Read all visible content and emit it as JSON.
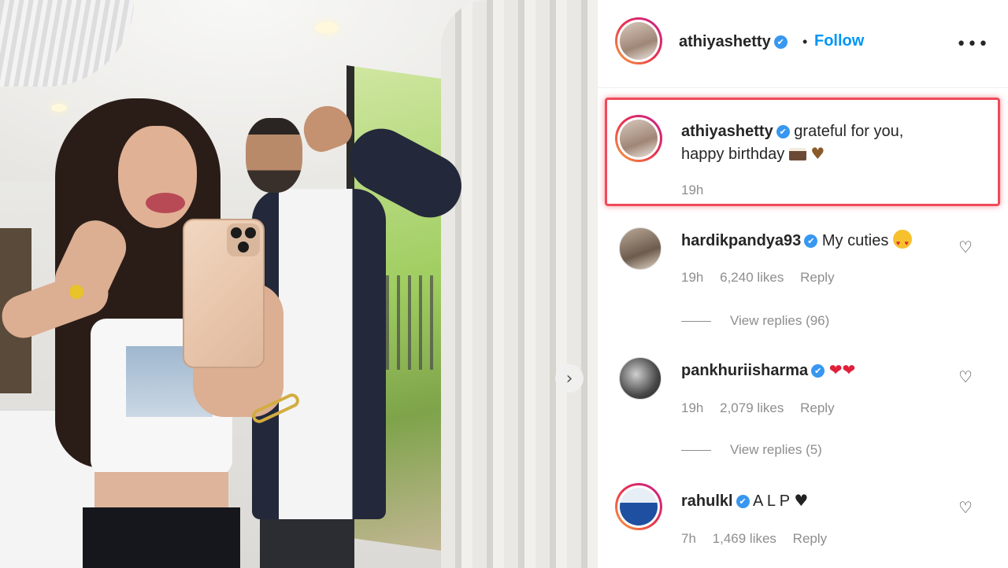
{
  "post": {
    "username": "athiyashetty",
    "follow_label": "Follow",
    "separator": "•",
    "more_label": "•••"
  },
  "caption": {
    "username": "athiyashetty",
    "text_line1": "grateful for you,",
    "text_line2": "happy birthday",
    "time": "19h"
  },
  "comments": [
    {
      "username": "hardikpandya93",
      "text": "My cuties",
      "time": "19h",
      "likes": "6,240 likes",
      "reply_label": "Reply",
      "view_replies": "View replies (96)"
    },
    {
      "username": "pankhuriisharma",
      "text": "❤❤",
      "time": "19h",
      "likes": "2,079 likes",
      "reply_label": "Reply",
      "view_replies": "View replies (5)"
    },
    {
      "username": "rahulkl",
      "text": "A L P",
      "trailing_emoji": "♥",
      "time": "7h",
      "likes": "1,469 likes",
      "reply_label": "Reply"
    }
  ],
  "icons": {
    "verified": "✔",
    "heart_outline": "♡",
    "next_arrow": "›",
    "heart_brown": "♥"
  },
  "colors": {
    "accent": "#0095f6",
    "highlight": "#ee4b5b",
    "muted": "#8e8e8e",
    "verified": "#3897f0"
  }
}
